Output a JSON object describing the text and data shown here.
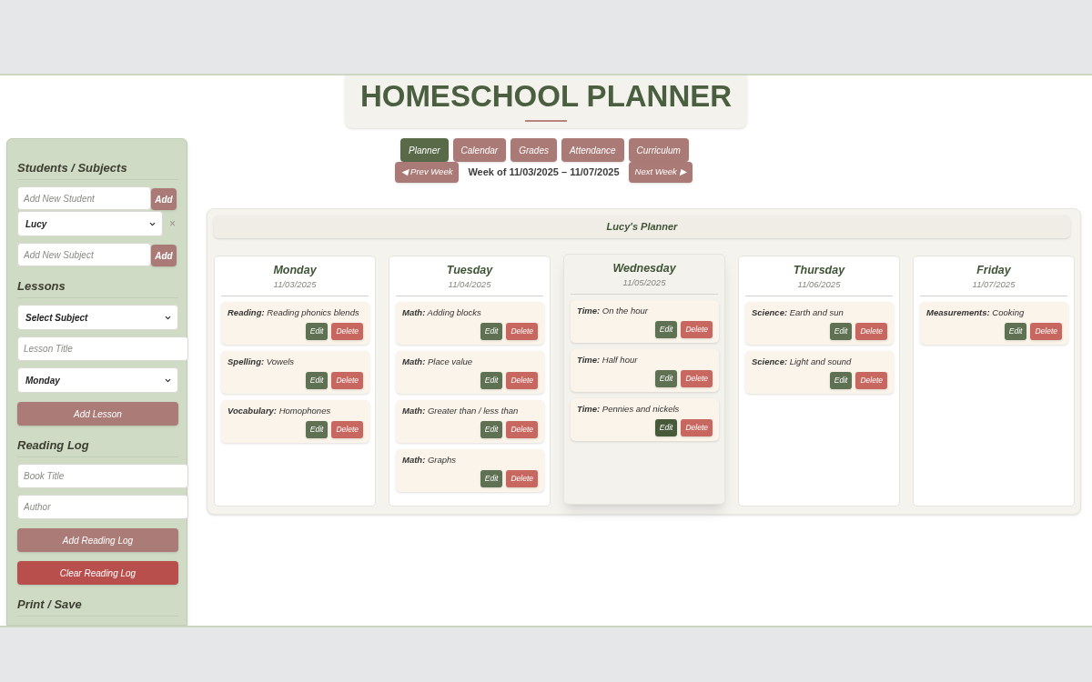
{
  "header": {
    "title": "HOMESCHOOL PLANNER"
  },
  "nav": {
    "tabs": [
      {
        "label": "Planner",
        "selected": true
      },
      {
        "label": "Calendar",
        "selected": false
      },
      {
        "label": "Grades",
        "selected": false
      },
      {
        "label": "Attendance",
        "selected": false
      },
      {
        "label": "Curriculum",
        "selected": false
      }
    ],
    "prev_button": "◀ Prev Week",
    "week_label": "Week of 11/03/2025 – 11/07/2025",
    "next_button": "Next Week ▶"
  },
  "sidebar": {
    "sections": [
      {
        "heading": "Students / Subjects",
        "controls": [
          {
            "kind": "input_with_button",
            "placeholder": "Add New Student",
            "button": "Add"
          },
          {
            "kind": "select_with_remove",
            "value": "Lucy",
            "remove": "×"
          },
          {
            "kind": "input_with_button",
            "placeholder": "Add New Subject",
            "button": "Add"
          }
        ]
      },
      {
        "heading": "Lessons",
        "controls": [
          {
            "kind": "select",
            "value": "Select Subject"
          },
          {
            "kind": "input",
            "placeholder": "Lesson Title"
          },
          {
            "kind": "select",
            "value": "Monday"
          },
          {
            "kind": "button",
            "label": "Add Lesson"
          }
        ]
      },
      {
        "heading": "Reading Log",
        "controls": [
          {
            "kind": "input",
            "placeholder": "Book Title"
          },
          {
            "kind": "input",
            "placeholder": "Author"
          },
          {
            "kind": "button",
            "label": "Add Reading Log"
          },
          {
            "kind": "danger_button",
            "label": "Clear Reading Log"
          }
        ]
      },
      {
        "heading": "Print / Save"
      }
    ]
  },
  "planner": {
    "title": "Lucy's Planner",
    "days": [
      {
        "name": "Monday",
        "date": "11/03/2025",
        "selected": false,
        "lessons": [
          {
            "text": "**Reading:** Reading phonics blends",
            "edit": "Edit",
            "delete": "Delete",
            "edit_active": false
          },
          {
            "text": "**Spelling:** Vowels",
            "edit": "Edit",
            "delete": "Delete",
            "edit_active": false
          },
          {
            "text": "**Vocabulary:** Homophones",
            "edit": "Edit",
            "delete": "Delete",
            "edit_active": false
          }
        ]
      },
      {
        "name": "Tuesday",
        "date": "11/04/2025",
        "selected": false,
        "lessons": [
          {
            "text": "**Math:** Adding blocks",
            "edit": "Edit",
            "delete": "Delete",
            "edit_active": false
          },
          {
            "text": "**Math:** Place value",
            "edit": "Edit",
            "delete": "Delete",
            "edit_active": false
          },
          {
            "text": "**Math:** Greater than / less than",
            "edit": "Edit",
            "delete": "Delete",
            "edit_active": false
          },
          {
            "text": "**Math:** Graphs",
            "edit": "Edit",
            "delete": "Delete",
            "edit_active": false
          }
        ]
      },
      {
        "name": "Wednesday",
        "date": "11/05/2025",
        "selected": true,
        "lessons": [
          {
            "text": "**Time:** On the hour",
            "edit": "Edit",
            "delete": "Delete",
            "edit_active": false
          },
          {
            "text": "**Time:** Half hour",
            "edit": "Edit",
            "delete": "Delete",
            "edit_active": false
          },
          {
            "text": "**Time:** Pennies and nickels",
            "edit": "Edit",
            "delete": "Delete",
            "edit_active": true
          }
        ]
      },
      {
        "name": "Thursday",
        "date": "11/06/2025",
        "selected": false,
        "lessons": [
          {
            "text": "**Science:** Earth and sun",
            "edit": "Edit",
            "delete": "Delete",
            "edit_active": false
          },
          {
            "text": "**Science:** Light and sound",
            "edit": "Edit",
            "delete": "Delete",
            "edit_active": false
          }
        ]
      },
      {
        "name": "Friday",
        "date": "11/07/2025",
        "selected": false,
        "lessons": [
          {
            "text": "**Measurements:** Cooking",
            "edit": "Edit",
            "delete": "Delete",
            "edit_active": false
          }
        ]
      }
    ]
  }
}
